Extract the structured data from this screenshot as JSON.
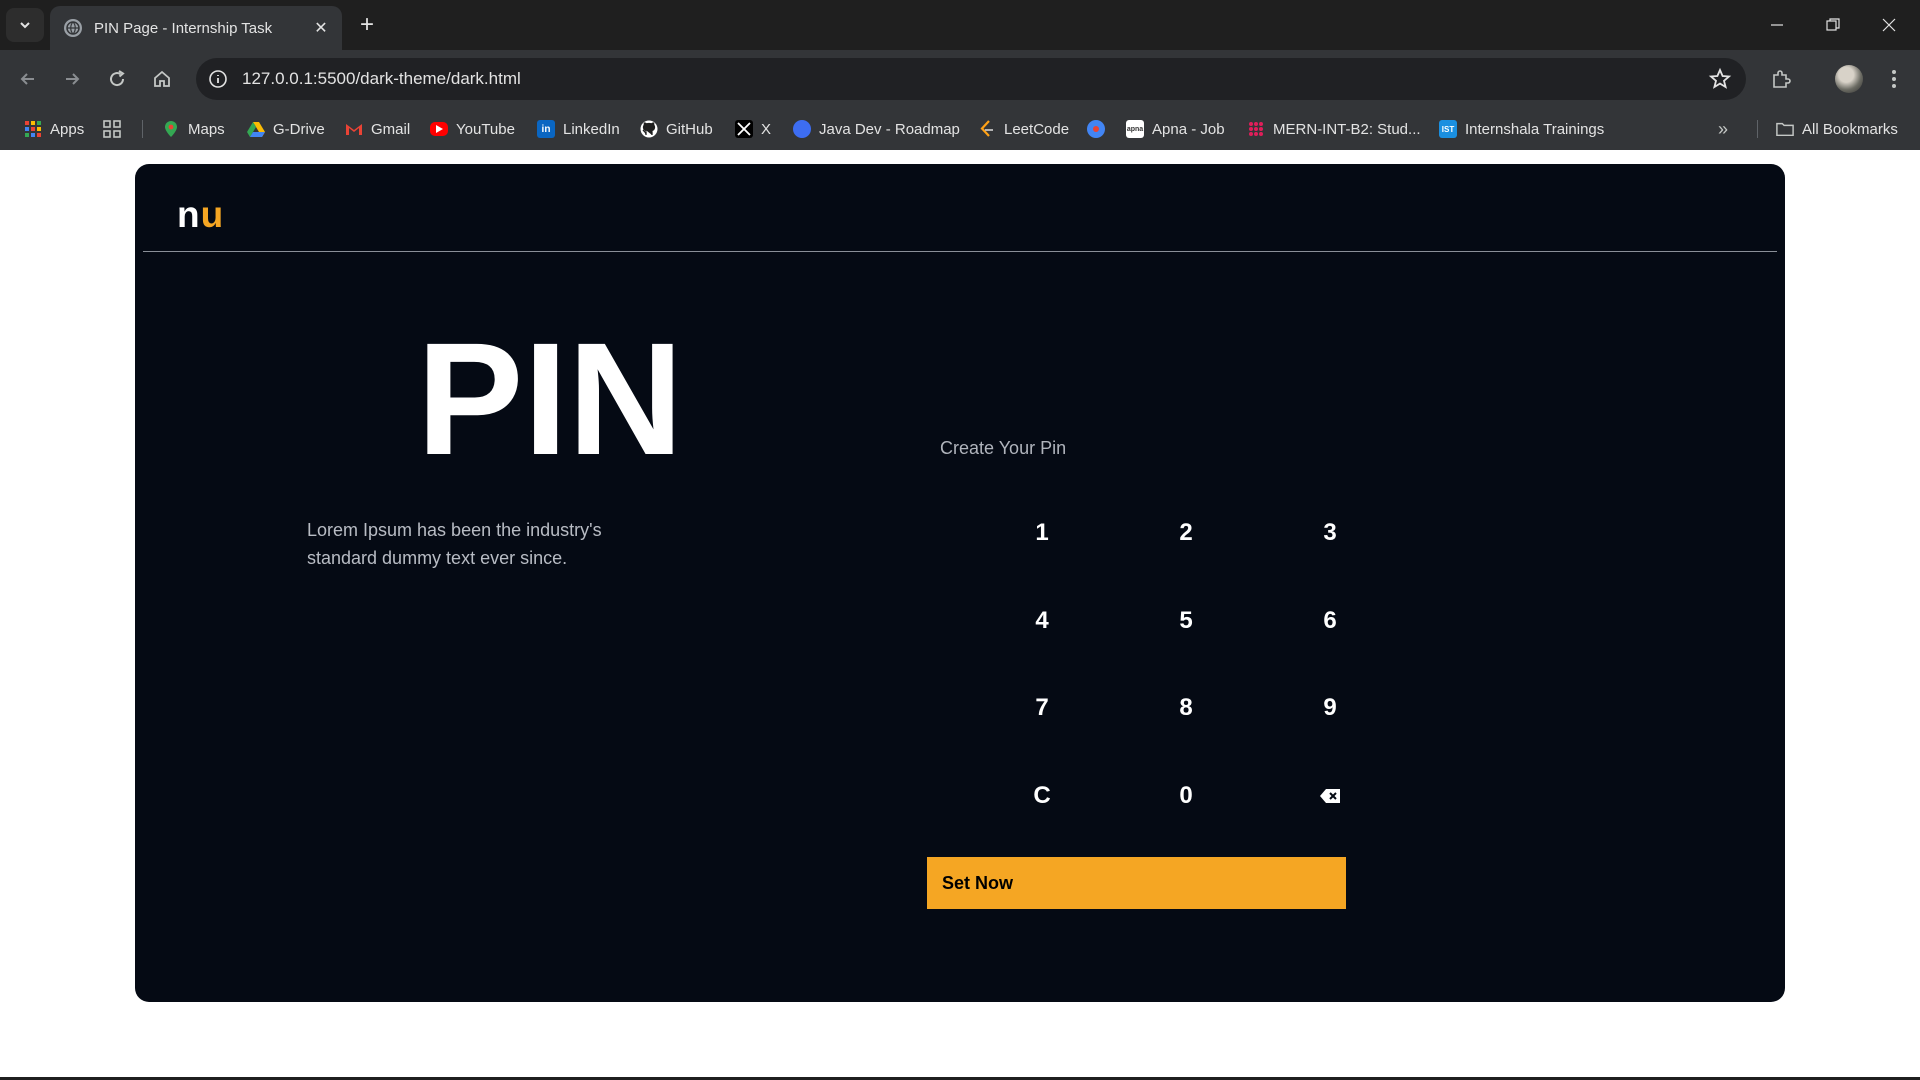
{
  "browser": {
    "tab_title": "PIN Page - Internship Task",
    "url": "127.0.0.1:5500/dark-theme/dark.html",
    "bookmarks": [
      {
        "label": "Apps",
        "icon": "apps-grid-icon"
      },
      {
        "label": "Maps",
        "icon": "maps-icon"
      },
      {
        "label": "G-Drive",
        "icon": "drive-icon"
      },
      {
        "label": "Gmail",
        "icon": "gmail-icon"
      },
      {
        "label": "YouTube",
        "icon": "youtube-icon"
      },
      {
        "label": "LinkedIn",
        "icon": "linkedin-icon"
      },
      {
        "label": "GitHub",
        "icon": "github-icon"
      },
      {
        "label": "X",
        "icon": "x-icon"
      },
      {
        "label": "Java Dev - Roadmap",
        "icon": "chat-bubble-icon"
      },
      {
        "label": "LeetCode",
        "icon": "leetcode-icon"
      },
      {
        "label": "Apna - Job",
        "icon": "apna-icon"
      },
      {
        "label": "MERN-INT-B2: Stud...",
        "icon": "slack-icon"
      },
      {
        "label": "Internshala Trainings",
        "icon": "internshala-icon"
      }
    ],
    "all_bookmarks_label": "All Bookmarks"
  },
  "page": {
    "logo": {
      "first": "n",
      "second": "u"
    },
    "hero_title": "PIN",
    "description": "Lorem Ipsum has been the industry's standard dummy text ever since.",
    "create_label": "Create Your Pin",
    "keys": [
      "1",
      "2",
      "3",
      "4",
      "5",
      "6",
      "7",
      "8",
      "9",
      "C",
      "0"
    ],
    "backspace_icon": "backspace-icon",
    "submit_label": "Set Now"
  },
  "colors": {
    "accent": "#f5a623",
    "card_background": "#050a14",
    "browser_frame": "#1f1f1f"
  }
}
